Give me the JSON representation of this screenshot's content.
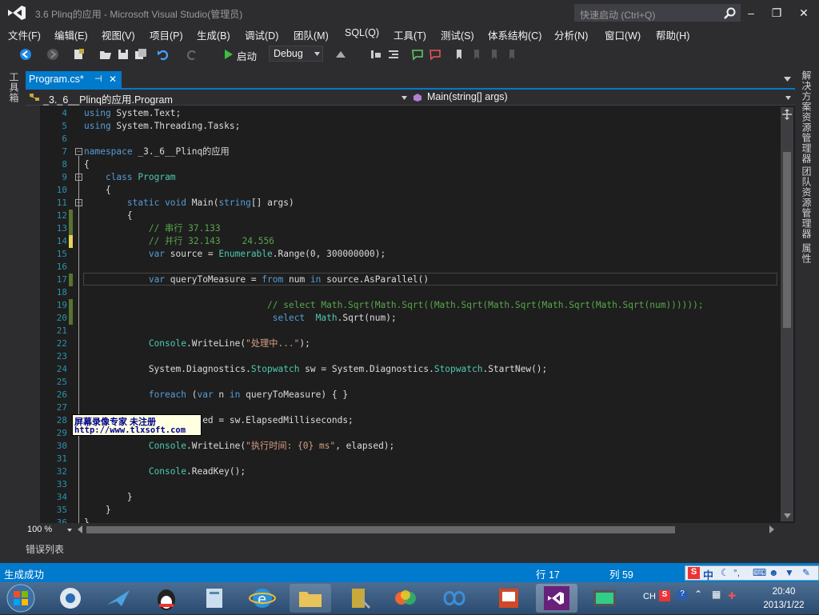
{
  "window": {
    "title": "3.6  Plinq的应用 - Microsoft Visual Studio(管理员)",
    "quick_launch_placeholder": "快速启动 (Ctrl+Q)",
    "minimize": "–",
    "restore": "❐",
    "close": "✕"
  },
  "menu": [
    "文件(F)",
    "编辑(E)",
    "视图(V)",
    "项目(P)",
    "生成(B)",
    "调试(D)",
    "团队(M)",
    "SQL(Q)",
    "工具(T)",
    "测试(S)",
    "体系结构(C)",
    "分析(N)",
    "窗口(W)",
    "帮助(H)"
  ],
  "toolbar": {
    "start_label": "启动",
    "config_value": "Debug"
  },
  "left_panel": {
    "toolbox_label": "工具箱"
  },
  "right_panel": {
    "items": [
      "解决方案资源管理器",
      "团队资源管理器",
      "属性"
    ]
  },
  "tab": {
    "label": "Program.cs*",
    "pin": "⊣",
    "close": "✕"
  },
  "nav": {
    "class_selector": "_3._6__Plinq的应用.Program",
    "member_selector": "Main(string[] args)"
  },
  "editor": {
    "lines": [
      {
        "n": "4",
        "html": "<span class='kw'>using</span> System.Text;"
      },
      {
        "n": "5",
        "html": "<span class='kw'>using</span> System.Threading.Tasks;"
      },
      {
        "n": "6",
        "html": ""
      },
      {
        "n": "7",
        "html": "<span class='kw'>namespace</span> _3._6__Plinq的应用"
      },
      {
        "n": "8",
        "html": "{"
      },
      {
        "n": "9",
        "html": "    <span class='kw'>class</span> <span class='ty'>Program</span>"
      },
      {
        "n": "10",
        "html": "    {"
      },
      {
        "n": "11",
        "html": "        <span class='kw'>static</span> <span class='kw'>void</span> Main(<span class='kw'>string</span>[] args)"
      },
      {
        "n": "12",
        "html": "        {"
      },
      {
        "n": "13",
        "html": "            <span class='cm'>// 串行 37.133</span>"
      },
      {
        "n": "14",
        "html": "            <span class='cm'>// 并行 32.143    24.556</span>"
      },
      {
        "n": "15",
        "html": "            <span class='kw'>var</span> source = <span class='ty'>Enumerable</span>.Range(0, 300000000);"
      },
      {
        "n": "16",
        "html": ""
      },
      {
        "n": "17",
        "html": "            <span class='kw'>var</span> queryToMeasure = <span class='kw'>from</span> num <span class='kw'>in</span> source.AsParallel()"
      },
      {
        "n": "18",
        "html": ""
      },
      {
        "n": "19",
        "html": "                                  <span class='cm'>// select Math.Sqrt(Math.Sqrt((Math.Sqrt(Math.Sqrt(Math.Sqrt(Math.Sqrt(num))))));</span>"
      },
      {
        "n": "20",
        "html": "                                   <span class='kw'>select</span>  <span class='ty'>Math</span>.Sqrt(num);"
      },
      {
        "n": "21",
        "html": ""
      },
      {
        "n": "22",
        "html": "            <span class='ty'>Console</span>.WriteLine(<span class='st'>\"处理中...\"</span>);"
      },
      {
        "n": "23",
        "html": ""
      },
      {
        "n": "24",
        "html": "            System.Diagnostics.<span class='ty'>Stopwatch</span> sw = System.Diagnostics.<span class='ty'>Stopwatch</span>.StartNew();"
      },
      {
        "n": "25",
        "html": ""
      },
      {
        "n": "26",
        "html": "            <span class='kw'>foreach</span> (<span class='kw'>var</span> n <span class='kw'>in</span> queryToMeasure) { }"
      },
      {
        "n": "27",
        "html": ""
      },
      {
        "n": "28",
        "html": "            <span class='kw'>long</span> elapsed = sw.ElapsedMilliseconds;"
      },
      {
        "n": "29",
        "html": ""
      },
      {
        "n": "30",
        "html": "            <span class='ty'>Console</span>.WriteLine(<span class='st'>\"执行时间: {0} ms\"</span>, elapsed);"
      },
      {
        "n": "31",
        "html": ""
      },
      {
        "n": "32",
        "html": "            <span class='ty'>Console</span>.ReadKey();"
      },
      {
        "n": "33",
        "html": ""
      },
      {
        "n": "34",
        "html": "        }"
      },
      {
        "n": "35",
        "html": "    }"
      },
      {
        "n": "36",
        "html": "}"
      }
    ]
  },
  "zoom": "100 %",
  "error_list_tab": "错误列表",
  "watermark": {
    "line1": "屏幕录像专家      未注册",
    "line2": "http://www.tlxsoft.com"
  },
  "status": {
    "message": "生成成功",
    "row": "行 17",
    "col": "列 59"
  },
  "taskbar": {
    "clock_time": "20:40",
    "clock_date": "2013/1/22",
    "lang": "CH"
  },
  "colors": {
    "accent": "#007acc",
    "bg": "#2d2d30",
    "editor_bg": "#1e1e1e"
  }
}
